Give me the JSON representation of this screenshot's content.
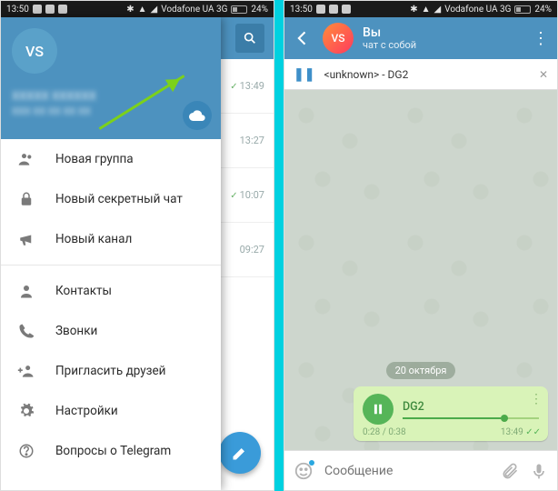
{
  "status": {
    "time": "13:50",
    "carrier": "Vodafone UA 3G",
    "battery": "24%"
  },
  "drawer": {
    "avatar": "VS",
    "user_name": "XXXXX XXXXXX",
    "user_phone": "XXX XX XX XX XX",
    "items": [
      {
        "label": "Новая группа"
      },
      {
        "label": "Новый секретный чат"
      },
      {
        "label": "Новый канал"
      },
      {
        "label": "Контакты"
      },
      {
        "label": "Звонки"
      },
      {
        "label": "Пригласить друзей"
      },
      {
        "label": "Настройки"
      },
      {
        "label": "Вопросы о Telegram"
      }
    ]
  },
  "chatlist": {
    "rows": [
      {
        "time": "13:49"
      },
      {
        "time": "13:27"
      },
      {
        "time": "10:07"
      },
      {
        "time": "09:27"
      }
    ]
  },
  "right": {
    "avatar": "VS",
    "title": "Вы",
    "subtitle": "чат с собой",
    "player_text": "<unknown> - DG2",
    "date_chip": "20 октября",
    "bubble": {
      "name": "DG2",
      "progress": "0:28 / 0:38",
      "time": "13:49"
    },
    "input_placeholder": "Сообщение"
  }
}
